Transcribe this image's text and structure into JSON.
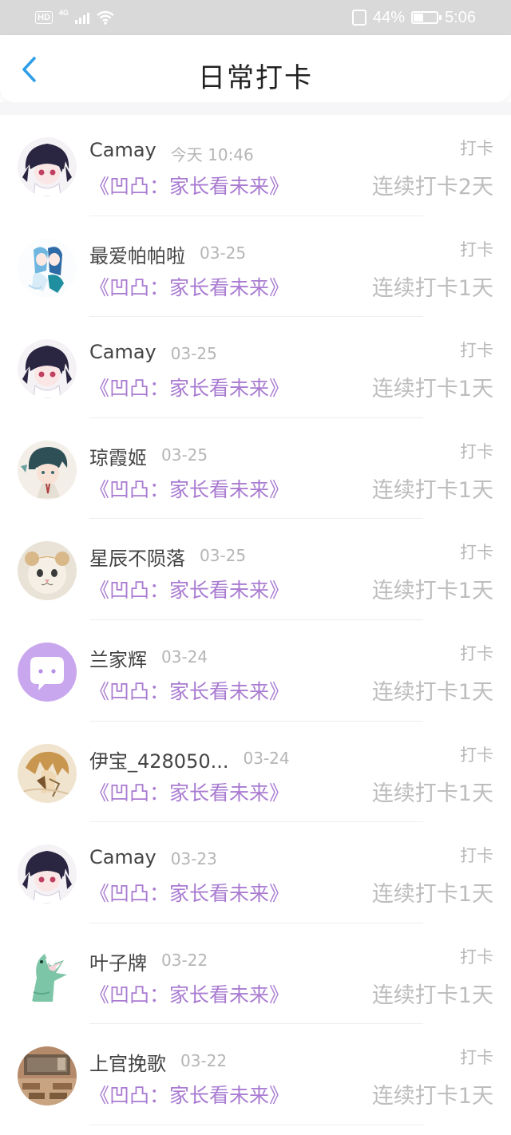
{
  "status_bar": {
    "hd": "HD",
    "network": "4G",
    "battery_percent": "44%",
    "battery_level": 0.44,
    "time": "5:06"
  },
  "header": {
    "back_icon": "chevron-left-icon",
    "title": "日常打卡",
    "accent": "#2f9ee8"
  },
  "colors": {
    "course": "#a97bd1",
    "muted": "#b5b5b5",
    "name": "#444444"
  },
  "checkins": [
    {
      "name": "Camay",
      "date": "今天 10:46",
      "course": "《凹凸：家长看未来》",
      "tag": "打卡",
      "streak": "连续打卡2天",
      "avatar": "anime-girl-avatar"
    },
    {
      "name": "最爱帕帕啦",
      "date": "03-25",
      "course": "《凹凸：家长看未来》",
      "tag": "打卡",
      "streak": "连续打卡1天",
      "avatar": "anime-duo-avatar"
    },
    {
      "name": "Camay",
      "date": "03-25",
      "course": "《凹凸：家长看未来》",
      "tag": "打卡",
      "streak": "连续打卡1天",
      "avatar": "anime-girl-avatar"
    },
    {
      "name": "琼霞姬",
      "date": "03-25",
      "course": "《凹凸：家长看未来》",
      "tag": "打卡",
      "streak": "连续打卡1天",
      "avatar": "anime-boy-avatar"
    },
    {
      "name": "星辰不陨落",
      "date": "03-25",
      "course": "《凹凸：家长看未来》",
      "tag": "打卡",
      "streak": "连续打卡1天",
      "avatar": "cat-avatar"
    },
    {
      "name": "兰家辉",
      "date": "03-24",
      "course": "《凹凸：家长看未来》",
      "tag": "打卡",
      "streak": "连续打卡1天",
      "avatar": "default-chat-avatar"
    },
    {
      "name": "伊宝_428050...",
      "date": "03-24",
      "course": "《凹凸：家长看未来》",
      "tag": "打卡",
      "streak": "连续打卡1天",
      "avatar": "sketch-avatar"
    },
    {
      "name": "Camay",
      "date": "03-23",
      "course": "《凹凸：家长看未来》",
      "tag": "打卡",
      "streak": "连续打卡1天",
      "avatar": "anime-girl-avatar"
    },
    {
      "name": "叶子牌",
      "date": "03-22",
      "course": "《凹凸：家长看未来》",
      "tag": "打卡",
      "streak": "连续打卡1天",
      "avatar": "dinosaur-avatar"
    },
    {
      "name": "上官挽歌",
      "date": "03-22",
      "course": "《凹凸：家长看未来》",
      "tag": "打卡",
      "streak": "连续打卡1天",
      "avatar": "classroom-avatar"
    }
  ]
}
